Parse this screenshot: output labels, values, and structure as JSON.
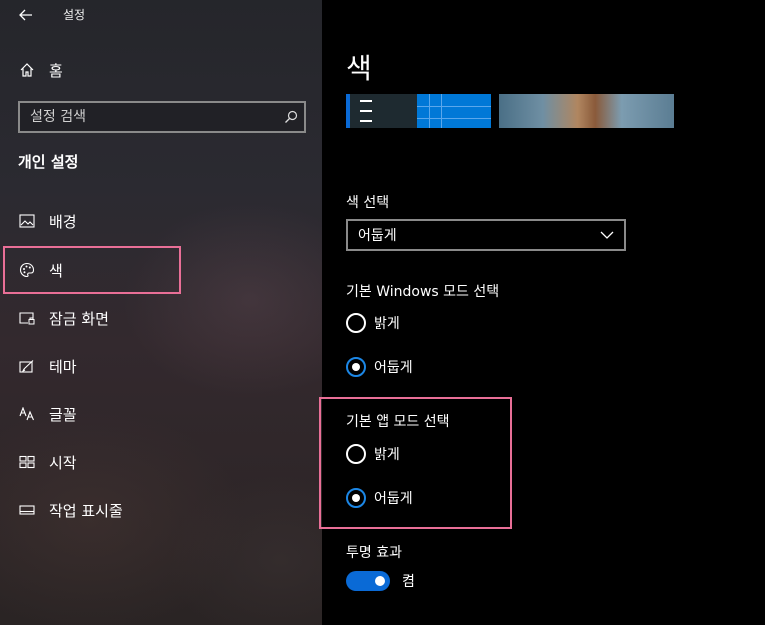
{
  "window": {
    "title": "설정"
  },
  "sidebar": {
    "home_label": "홈",
    "search_placeholder": "설정 검색",
    "section_title": "개인 설정",
    "items": [
      {
        "label": "배경",
        "icon": "image-icon"
      },
      {
        "label": "색",
        "icon": "palette-icon",
        "selected": true
      },
      {
        "label": "잠금 화면",
        "icon": "lock-screen-icon"
      },
      {
        "label": "테마",
        "icon": "theme-icon"
      },
      {
        "label": "글꼴",
        "icon": "font-icon"
      },
      {
        "label": "시작",
        "icon": "start-icon"
      },
      {
        "label": "작업 표시줄",
        "icon": "taskbar-icon"
      }
    ]
  },
  "main": {
    "title": "색",
    "color_select": {
      "label": "색 선택",
      "value": "어둡게"
    },
    "windows_mode": {
      "label": "기본 Windows 모드 선택",
      "options": [
        "밝게",
        "어둡게"
      ],
      "selected": "어둡게"
    },
    "app_mode": {
      "label": "기본 앱 모드 선택",
      "options": [
        "밝게",
        "어둡게"
      ],
      "selected": "어둡게"
    },
    "transparency": {
      "label": "투명 효과",
      "state": "켬",
      "on": true
    }
  },
  "colors": {
    "accent": "#0078d7",
    "highlight_box": "#e96f97",
    "radio_checked": "#1c87e6"
  }
}
